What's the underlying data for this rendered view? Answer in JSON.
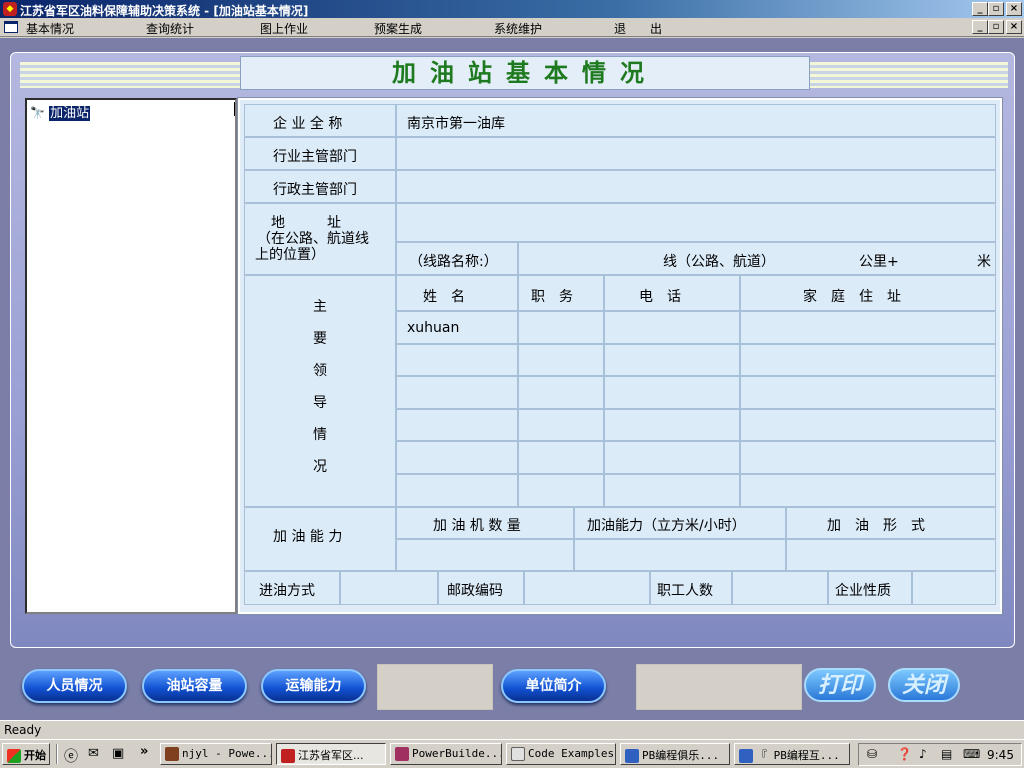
{
  "window": {
    "title": "江苏省军区油料保障辅助决策系统 - [加油站基本情况]"
  },
  "menu": [
    "基本情况",
    "查询统计",
    "图上作业",
    "预案生成",
    "系统维护",
    "退　　出"
  ],
  "form_title": "加油站基本情况",
  "tree": {
    "root_label": "加油站"
  },
  "form": {
    "company_name_label": "企 业 全 称",
    "company_name_value": "南京市第一油库",
    "industry_dept_label": "行业主管部门",
    "admin_dept_label": "行政主管部门",
    "address_label_1": "地　　　址",
    "address_label_2": "（在公路、航道线",
    "address_label_3": "上的位置）",
    "route_name_label": "（线路名称:）",
    "route_line_label": "线（公路、航道）",
    "km_label": "公里+",
    "m_label": "米",
    "leaders_label": [
      "主",
      "要",
      "领",
      "导",
      "情",
      "况"
    ],
    "leaders_headers": [
      "姓　名",
      "职　务",
      "电　话",
      "家　庭　住　址"
    ],
    "leaders_rows": [
      [
        "xuhuan",
        "",
        "",
        ""
      ],
      [
        "",
        "",
        "",
        ""
      ],
      [
        "",
        "",
        "",
        ""
      ],
      [
        "",
        "",
        "",
        ""
      ],
      [
        "",
        "",
        "",
        ""
      ],
      [
        "",
        "",
        "",
        ""
      ]
    ],
    "capacity_label": "加 油 能 力",
    "pump_count_label": "加 油 机 数 量",
    "capacity_rate_label": "加油能力（立方米/小时）",
    "fueling_type_label": "加　油　形　式",
    "oil_intake_label": "进油方式",
    "postcode_label": "邮政编码",
    "staff_count_label": "职工人数",
    "enterprise_type_label": "企业性质"
  },
  "buttons": {
    "personnel": "人员情况",
    "station_capacity": "油站容量",
    "transport": "运输能力",
    "unit_intro": "单位简介",
    "print": "打印",
    "close": "关闭"
  },
  "status": "Ready",
  "taskbar": {
    "start": "开始",
    "items": [
      "njyl - Powe...",
      "江苏省军区...",
      "PowerBuilde...",
      "Code Examples",
      "PB编程俱乐...",
      "『 PB编程互..."
    ],
    "clock": "9:45"
  },
  "colors": {
    "title_green": "#1e7a1e",
    "mdi_bg": "#7b7fa8",
    "form_bg": "#dcebf8",
    "button_blue": "#1050d0"
  }
}
